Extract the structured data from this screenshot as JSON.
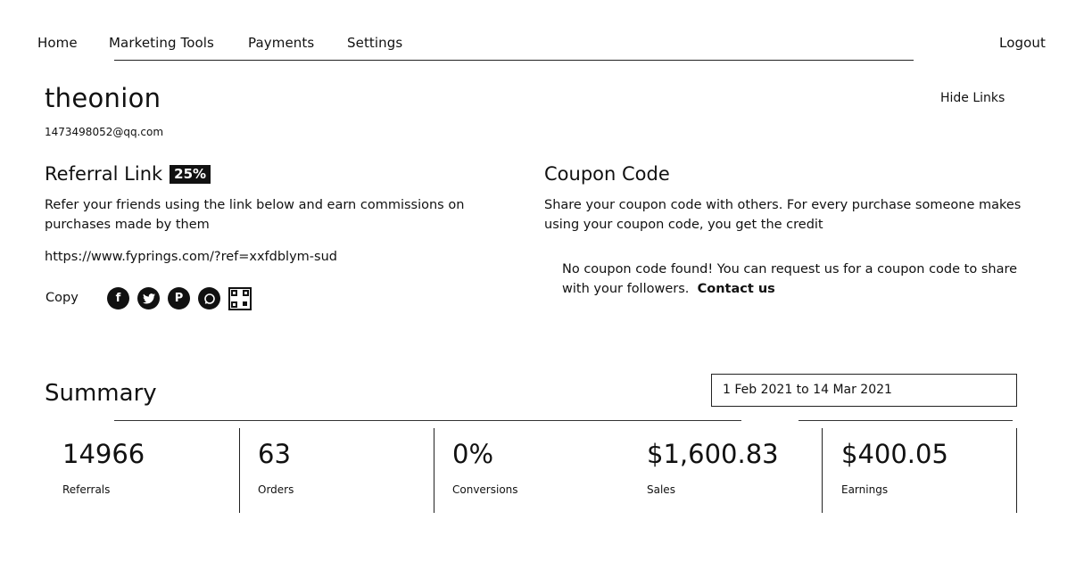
{
  "nav": {
    "items": [
      "Home",
      "Marketing Tools",
      "Payments",
      "Settings"
    ],
    "logout": "Logout"
  },
  "profile": {
    "username": "theonion",
    "email": "1473498052@qq.com",
    "hide_links": "Hide Links"
  },
  "referral": {
    "title": "Referral Link",
    "badge": "25%",
    "description": "Refer your friends using the link below and earn commissions on purchases made by them",
    "link": "https://www.fyprings.com/?ref=xxfdblym-sud",
    "copy_label": "Copy",
    "share_icons": [
      "facebook-icon",
      "twitter-icon",
      "pinterest-icon",
      "whatsapp-icon",
      "qr-code-icon"
    ]
  },
  "coupon": {
    "title": "Coupon Code",
    "description": "Share your coupon code with others. For every purchase someone makes using your coupon code, you get the credit",
    "note": "No coupon code found! You can request us for a coupon code to share with your followers.",
    "contact_label": "Contact us"
  },
  "summary": {
    "title": "Summary",
    "date_range": "1 Feb 2021 to 14 Mar 2021",
    "stats": [
      {
        "value": "14966",
        "label": "Referrals"
      },
      {
        "value": "63",
        "label": "Orders"
      },
      {
        "value": "0%",
        "label": "Conversions"
      },
      {
        "value": "$1,600.83",
        "label": "Sales"
      },
      {
        "value": "$400.05",
        "label": "Earnings"
      }
    ]
  }
}
